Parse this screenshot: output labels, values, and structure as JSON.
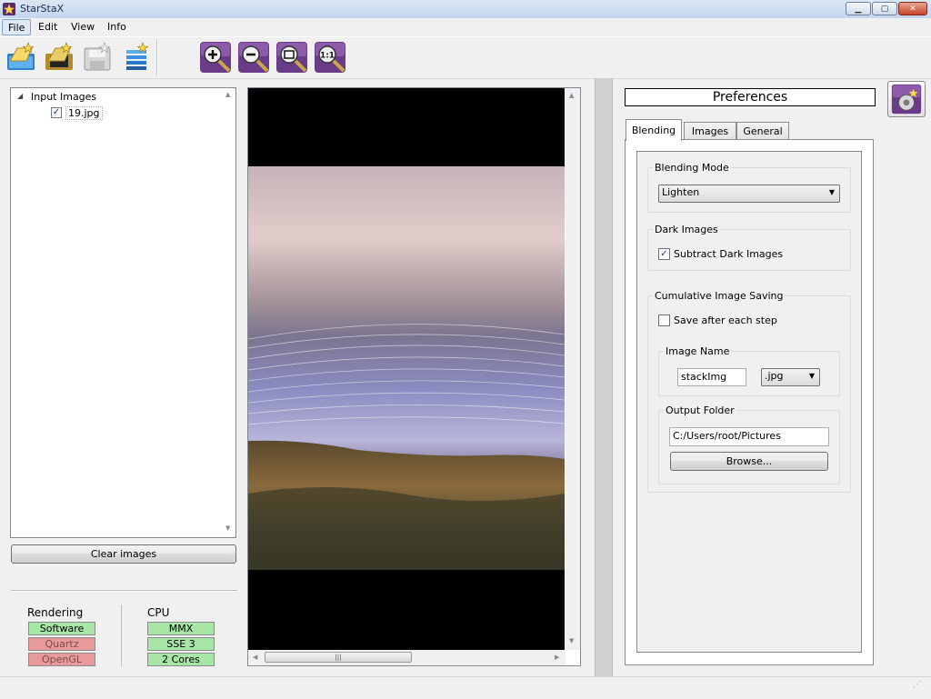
{
  "window": {
    "title": "StarStaX",
    "min_icon": "minimize-icon",
    "max_icon": "maximize-icon",
    "close_icon": "close-icon"
  },
  "menu": {
    "file": "File",
    "edit": "Edit",
    "view": "View",
    "info": "Info"
  },
  "toolbar": {
    "icons": [
      "open-images-icon",
      "open-dark-images-icon",
      "save-icon",
      "process-icon",
      "zoom-in-icon",
      "zoom-out-icon",
      "zoom-fit-icon",
      "zoom-actual-size-icon"
    ]
  },
  "tree": {
    "root_label": "Input Images",
    "items": [
      {
        "label": "19.jpg",
        "checked": true
      }
    ]
  },
  "left": {
    "clear_label": "Clear images"
  },
  "status": {
    "rendering_title": "Rendering",
    "cpu_title": "CPU",
    "rendering": [
      {
        "label": "Software",
        "active": true
      },
      {
        "label": "Quartz",
        "active": false
      },
      {
        "label": "OpenGL",
        "active": false
      }
    ],
    "cpu": [
      {
        "label": "MMX",
        "active": true
      },
      {
        "label": "SSE 3",
        "active": true
      },
      {
        "label": "2 Cores",
        "active": true
      }
    ],
    "colors": {
      "active": "#a8e6a8",
      "inactive": "#e89a9a"
    }
  },
  "prefs": {
    "header": "Preferences",
    "tabs": [
      "Blending",
      "Images",
      "General"
    ],
    "blending_mode_label": "Blending Mode",
    "blending_mode_value": "Lighten",
    "dark_images_label": "Dark Images",
    "subtract_dark_label": "Subtract Dark Images",
    "subtract_dark_checked": true,
    "cumulative_label": "Cumulative Image Saving",
    "save_after_label": "Save after each step",
    "save_after_checked": false,
    "image_name_label": "Image Name",
    "image_name_value": "stackImg",
    "extension_value": ".jpg",
    "output_folder_label": "Output Folder",
    "output_folder_value": "C:/Users/root/Pictures",
    "browse_label": "Browse..."
  }
}
